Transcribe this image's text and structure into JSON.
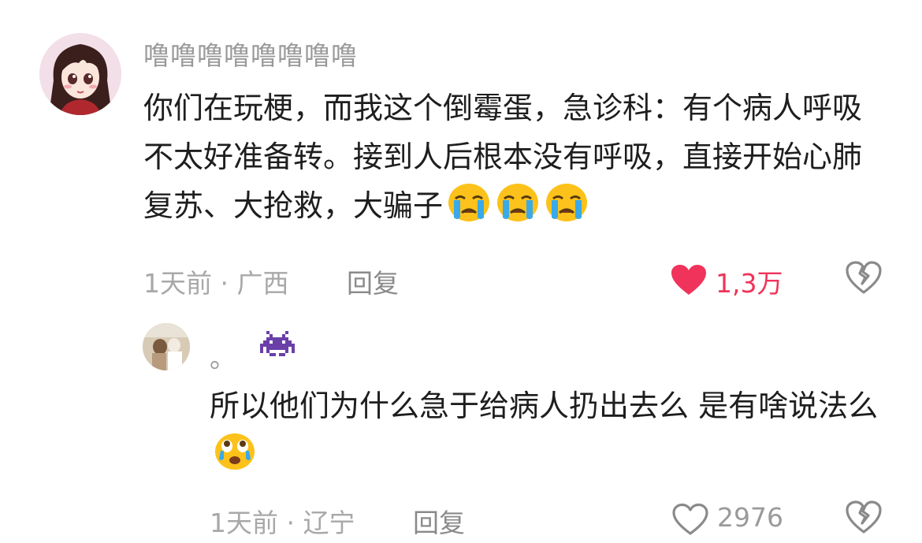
{
  "comments": [
    {
      "username": "噜噜噜噜噜噜噜噜",
      "text": "你们在玩梗，而我这个倒霉蛋，急诊科：有个病人呼吸不太好准备转。接到人后根本没有呼吸，直接开始心肺复苏、大抢救，大骗子",
      "emojis": [
        "crying-face-icon",
        "crying-face-icon",
        "crying-face-icon"
      ],
      "time": "1天前",
      "separator": "·",
      "location": "广西",
      "reply_label": "回复",
      "like_count": "1,3万",
      "liked": true
    },
    {
      "username": "。",
      "username_emoji": "alien-monster-icon",
      "text": "所以他们为什么急于给病人扔出去么 是有啥说法么",
      "emojis": [
        "teary-eyed-face-icon"
      ],
      "time": "1天前",
      "separator": "·",
      "location": "辽宁",
      "reply_label": "回复",
      "like_count": "2976",
      "liked": false
    }
  ],
  "colors": {
    "liked_red": "#f0335a",
    "meta_gray": "#a8a8a8",
    "text": "#1e1e1e"
  }
}
